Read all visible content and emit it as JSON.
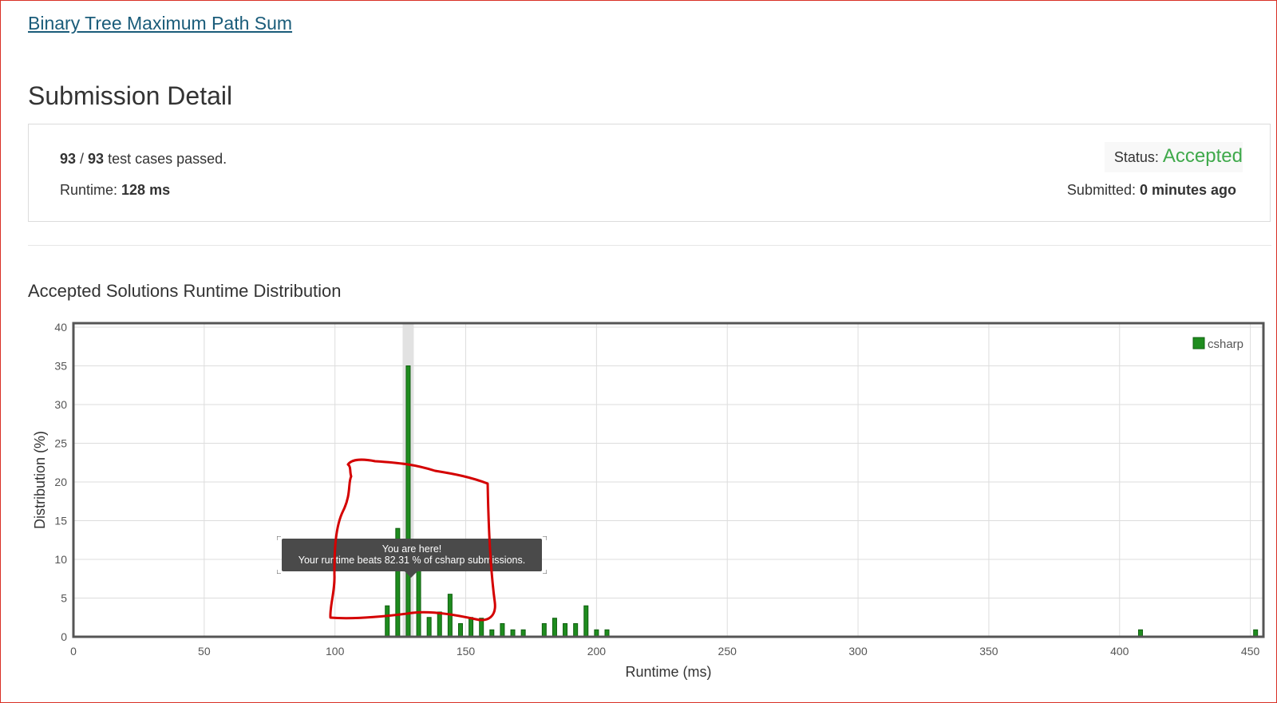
{
  "problem": {
    "title": "Binary Tree Maximum Path Sum"
  },
  "page": {
    "title": "Submission Detail"
  },
  "summary": {
    "passed": "93",
    "separator": " / ",
    "total": "93",
    "passed_suffix": " test cases passed.",
    "runtime_label": "Runtime: ",
    "runtime_value": "128 ms",
    "status_label": "Status: ",
    "status_value": "Accepted",
    "submitted_label": "Submitted: ",
    "submitted_value": "0 minutes ago"
  },
  "distribution": {
    "section_title": "Accepted Solutions Runtime Distribution",
    "tooltip_line1": "You are here!",
    "tooltip_line2": "Your runtime beats 82.31 % of csharp submissions."
  },
  "colors": {
    "accepted": "#3fa94b",
    "bar": "#1e8c1e",
    "bar_border": "#0f5f0f",
    "highlight": "#e2e2e2",
    "annotation": "#d40000"
  },
  "chart_data": {
    "type": "bar",
    "xlabel": "Runtime (ms)",
    "ylabel": "Distribution (%)",
    "xlim": [
      0,
      455
    ],
    "ylim": [
      0,
      40
    ],
    "x_ticks": [
      0,
      50,
      100,
      150,
      200,
      250,
      300,
      350,
      400,
      450
    ],
    "y_ticks": [
      0,
      5,
      10,
      15,
      20,
      25,
      30,
      35,
      40
    ],
    "grid": true,
    "legend_position": "top-right",
    "highlight_x": 128,
    "series": [
      {
        "name": "csharp",
        "points": [
          {
            "x": 120,
            "y": 4
          },
          {
            "x": 124,
            "y": 14
          },
          {
            "x": 128,
            "y": 35
          },
          {
            "x": 132,
            "y": 12
          },
          {
            "x": 136,
            "y": 2.5
          },
          {
            "x": 140,
            "y": 3.2
          },
          {
            "x": 144,
            "y": 5.5
          },
          {
            "x": 148,
            "y": 1.7
          },
          {
            "x": 152,
            "y": 2.5
          },
          {
            "x": 156,
            "y": 2.4
          },
          {
            "x": 160,
            "y": 0.9
          },
          {
            "x": 164,
            "y": 1.7
          },
          {
            "x": 168,
            "y": 0.9
          },
          {
            "x": 172,
            "y": 0.9
          },
          {
            "x": 180,
            "y": 1.7
          },
          {
            "x": 184,
            "y": 2.4
          },
          {
            "x": 188,
            "y": 1.7
          },
          {
            "x": 192,
            "y": 1.7
          },
          {
            "x": 196,
            "y": 4
          },
          {
            "x": 200,
            "y": 0.9
          },
          {
            "x": 204,
            "y": 0.9
          },
          {
            "x": 408,
            "y": 0.9
          },
          {
            "x": 452,
            "y": 0.9
          }
        ]
      }
    ]
  }
}
